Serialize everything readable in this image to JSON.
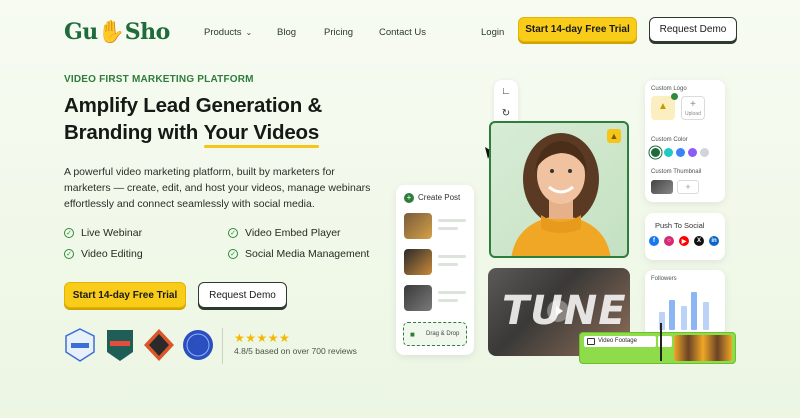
{
  "nav": {
    "logo_text_left": "Gu",
    "logo_text_right": "Sho",
    "logo_hand": "👍",
    "products": "Products",
    "blog": "Blog",
    "pricing": "Pricing",
    "contact": "Contact Us",
    "login": "Login",
    "trial_label": "Start 14-day Free Trial",
    "demo_label": "Request Demo"
  },
  "hero": {
    "eyebrow": "VIDEO FIRST MARKETING PLATFORM",
    "title_line1": "Amplify Lead Generation &",
    "title_line2_prefix": "Branding with ",
    "title_line2_highlight": "Your Videos",
    "description": "A powerful video marketing platform, built by marketers for marketers — create, edit, and host your videos, manage webinars effortlessly and connect seamlessly with social media.",
    "features": [
      "Live Webinar",
      "Video Embed Player",
      "Video Editing",
      "Social Media Management"
    ],
    "cta_trial": "Start 14-day Free Trial",
    "cta_demo": "Request Demo",
    "stars": "★★★★★",
    "rating_text": "4.8/5 based on over 700 reviews"
  },
  "mockup": {
    "create_post": "Create Post",
    "drag_drop": "Drag & Drop",
    "custom_logo": "Custom Logo",
    "upload": "Upload",
    "custom_color": "Custom Color",
    "custom_thumbnail": "Custom Thumbnail",
    "push_to_social": "Push To Social",
    "followers": "Followers",
    "video_footage": "Video Footage",
    "tune_text": "TUNE"
  },
  "colors": {
    "brand_green": "#2e7d3b",
    "accent_yellow": "#f8cc18",
    "swatches": [
      "#1f6b3c",
      "#1ec9c9",
      "#3b82f6",
      "#8b5cf6",
      "#d1d5db"
    ]
  }
}
